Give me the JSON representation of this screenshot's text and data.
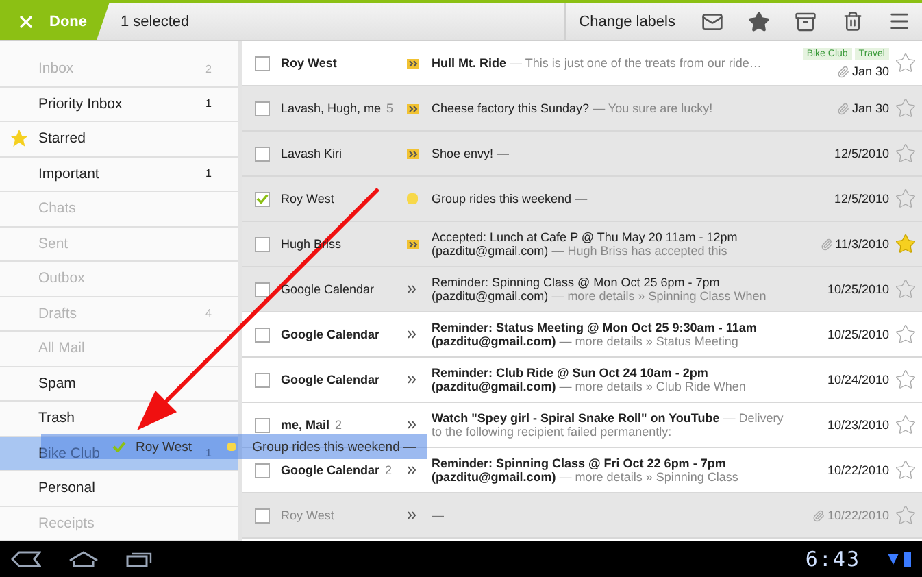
{
  "top_bar": {
    "done_label": "Done",
    "selection": "1 selected",
    "change_labels": "Change labels"
  },
  "sidebar": {
    "items": [
      {
        "label": "Inbox",
        "count": "2",
        "kind": "plain",
        "disabled": true,
        "selected": false
      },
      {
        "label": "Priority Inbox",
        "count": "1",
        "kind": "plain",
        "disabled": false,
        "selected": false
      },
      {
        "label": "Starred",
        "kind": "starred",
        "disabled": false,
        "selected": false
      },
      {
        "label": "Important",
        "count": "1",
        "kind": "plain",
        "disabled": false,
        "selected": false
      },
      {
        "label": "Chats",
        "kind": "plain",
        "disabled": true,
        "selected": false
      },
      {
        "label": "Sent",
        "kind": "plain",
        "disabled": true,
        "selected": false
      },
      {
        "label": "Outbox",
        "kind": "plain",
        "disabled": true,
        "selected": false
      },
      {
        "label": "Drafts",
        "count": "4",
        "kind": "plain",
        "disabled": true,
        "selected": false
      },
      {
        "label": "All Mail",
        "kind": "plain",
        "disabled": true,
        "selected": false
      },
      {
        "label": "Spam",
        "kind": "plain",
        "disabled": false,
        "selected": false
      },
      {
        "label": "Trash",
        "kind": "plain",
        "disabled": false,
        "selected": false
      },
      {
        "label": "Bike Club",
        "count": "1",
        "kind": "plain",
        "disabled": false,
        "selected": true
      },
      {
        "label": "Personal",
        "kind": "plain",
        "disabled": false,
        "selected": false
      },
      {
        "label": "Receipts",
        "kind": "plain",
        "disabled": true,
        "selected": false
      }
    ]
  },
  "messages": [
    {
      "checked": false,
      "unread": true,
      "faded": false,
      "sender": "Roy West",
      "kind": "important",
      "subject": "Hull Mt. Ride",
      "snippet": "— This is just one of the treats from our ride…",
      "labels": [
        {
          "name": "Bike Club"
        },
        {
          "name": "Travel"
        }
      ],
      "attachment": true,
      "date": "Jan 30",
      "starred": false
    },
    {
      "checked": false,
      "unread": false,
      "faded": false,
      "sender": "Lavash, Hugh, me",
      "count": "5",
      "kind": "important",
      "subject": "Cheese factory this Sunday?",
      "snippet": "— You sure are lucky!",
      "attachment": true,
      "date": "Jan 30",
      "starred": false
    },
    {
      "checked": false,
      "unread": false,
      "faded": false,
      "sender": "Lavash Kiri",
      "kind": "important",
      "subject": "Shoe envy!",
      "snippet": "—",
      "attachment": false,
      "date": "12/5/2010",
      "starred": false
    },
    {
      "checked": true,
      "unread": false,
      "faded": false,
      "sender": "Roy West",
      "kind": "dot",
      "subject": "Group rides this weekend",
      "snippet": "—",
      "attachment": false,
      "date": "12/5/2010",
      "starred": false
    },
    {
      "checked": false,
      "unread": false,
      "faded": false,
      "sender": "Hugh Briss",
      "kind": "important",
      "subject": "Accepted: Lunch at Cafe P @ Thu May 20 11am - 12pm (pazditu@gmail.com)",
      "snippet": "— Hugh Briss has accepted this",
      "attachment": true,
      "date": "11/3/2010",
      "starred": true
    },
    {
      "checked": false,
      "unread": false,
      "faded": false,
      "sender": "Google Calendar",
      "kind": "plain",
      "subject": "Reminder: Spinning Class @ Mon Oct 25 6pm - 7pm (pazditu@gmail.com)",
      "snippet": "— more details » Spinning Class When",
      "attachment": false,
      "date": "10/25/2010",
      "starred": false
    },
    {
      "checked": false,
      "unread": true,
      "faded": false,
      "sender": "Google Calendar",
      "kind": "plain",
      "subject": "Reminder: Status Meeting @ Mon Oct 25 9:30am - 11am (pazditu@gmail.com)",
      "snippet": "— more details » Status Meeting",
      "attachment": false,
      "date": "10/25/2010",
      "starred": false
    },
    {
      "checked": false,
      "unread": true,
      "faded": false,
      "sender": "Google Calendar",
      "kind": "plain",
      "subject": "Reminder: Club Ride @ Sun Oct 24 10am - 2pm (pazditu@gmail.com)",
      "snippet": "— more details » Club Ride When",
      "attachment": false,
      "date": "10/24/2010",
      "starred": false
    },
    {
      "checked": false,
      "unread": true,
      "faded": false,
      "sender": "me, **Mail**",
      "count": "2",
      "kind": "plain",
      "subject": "Watch \"Spey girl - Spiral Snake Roll\" on YouTube",
      "snippet": "— Delivery to the following recipient failed permanently:",
      "attachment": false,
      "date": "10/23/2010",
      "starred": false
    },
    {
      "checked": false,
      "unread": true,
      "faded": false,
      "sender": "Google Calendar",
      "count": "2",
      "kind": "plain",
      "subject": "Reminder: Spinning Class @ Fri Oct 22 6pm - 7pm (pazditu@gmail.com)",
      "snippet": "— more details » Spinning Class",
      "attachment": false,
      "date": "10/22/2010",
      "starred": false
    },
    {
      "checked": false,
      "unread": false,
      "faded": true,
      "sender": "Roy West",
      "kind": "plain",
      "snippet": "—",
      "attachment": true,
      "date": "10/22/2010",
      "starred": false
    }
  ],
  "drag_preview": {
    "sender": "Roy West",
    "subject": "Group rides this weekend —"
  },
  "status_bar": {
    "time": "6:43"
  }
}
